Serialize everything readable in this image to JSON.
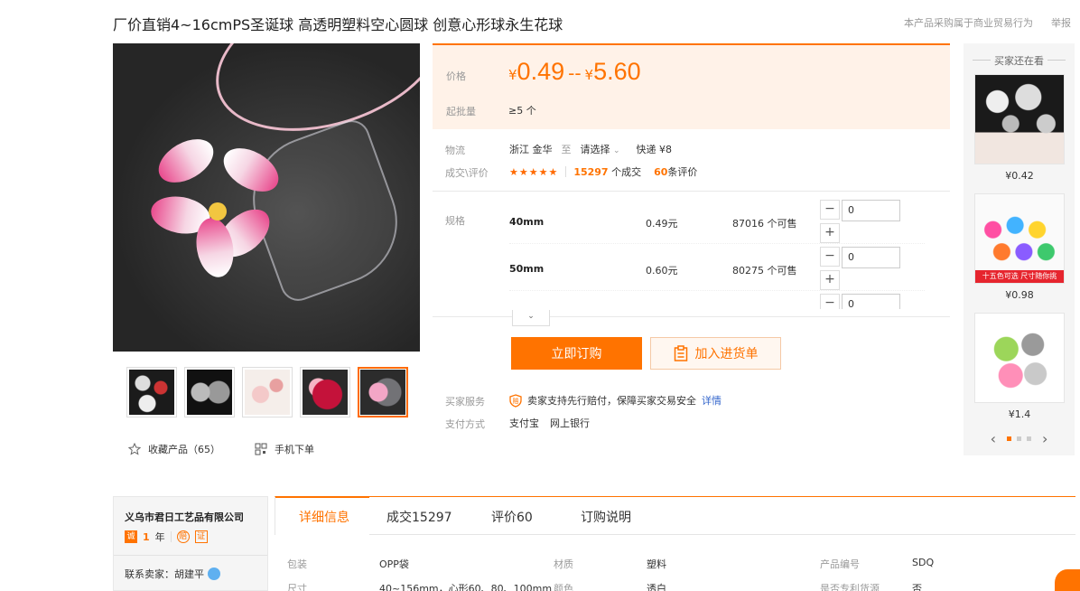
{
  "title": "厂价直销4~16cmPS圣诞球 高透明塑料空心圆球 创意心形球永生花球",
  "top_notice": "本产品采购属于商业贸易行为",
  "report_label": "举报",
  "gallery": {
    "collect_label": "收藏产品（65）",
    "mobile_label": "手机下单"
  },
  "price": {
    "label": "价格",
    "currency": "¥",
    "low": "0.49",
    "dash": "--",
    "high": "5.60",
    "min_label": "起批量",
    "min_value": "≥5 个"
  },
  "logistics": {
    "label": "物流",
    "from": "浙江 金华",
    "to_word": "至",
    "dest": "请选择",
    "express": "快递 ¥8"
  },
  "trade": {
    "label": "成交\\评价",
    "stars": "★★★★★",
    "deals_num": "15297",
    "deals_word": "个成交",
    "reviews_num": "60",
    "reviews_word": "条评价"
  },
  "spec": {
    "label": "规格",
    "rows": [
      {
        "name": "40mm",
        "price": "0.49元",
        "stock": "87016 个可售",
        "qty": "0"
      },
      {
        "name": "50mm",
        "price": "0.60元",
        "stock": "80275 个可售",
        "qty": "0"
      },
      {
        "name": "",
        "price": "",
        "stock": "",
        "qty": "0"
      }
    ]
  },
  "buttons": {
    "order": "立即订购",
    "cart": "加入进货单"
  },
  "service": {
    "label": "买家服务",
    "text": "卖家支持先行赔付，保障买家交易安全",
    "link": "详情"
  },
  "payment": {
    "label": "支付方式",
    "methods": [
      "支付宝",
      "网上银行"
    ]
  },
  "others": {
    "title": "买家还在看",
    "items": [
      {
        "price": "¥0.42"
      },
      {
        "price": "¥0.98",
        "banner": "十五色可选 尺寸随你挑"
      },
      {
        "price": "¥1.4"
      }
    ]
  },
  "company": {
    "name": "义乌市君日工艺品有限公司",
    "years_num": "1",
    "years_word": "年",
    "contact": "联系卖家：胡建平"
  },
  "tabs": [
    "详细信息",
    "成交15297",
    "评价60",
    "订购说明"
  ],
  "attributes": [
    {
      "k": "包装",
      "v": "OPP袋"
    },
    {
      "k": "材质",
      "v": "塑料"
    },
    {
      "k": "产品编号",
      "v": "SDQ"
    },
    {
      "k": "尺寸",
      "v": "40~156mm，心形60、80、100mm"
    },
    {
      "k": "颜色",
      "v": "透白"
    },
    {
      "k": "是否专利货源",
      "v": "否"
    }
  ],
  "colors": {
    "accent": "#ff7300",
    "price_bg": "#fff2e8",
    "link": "#3366cc"
  }
}
